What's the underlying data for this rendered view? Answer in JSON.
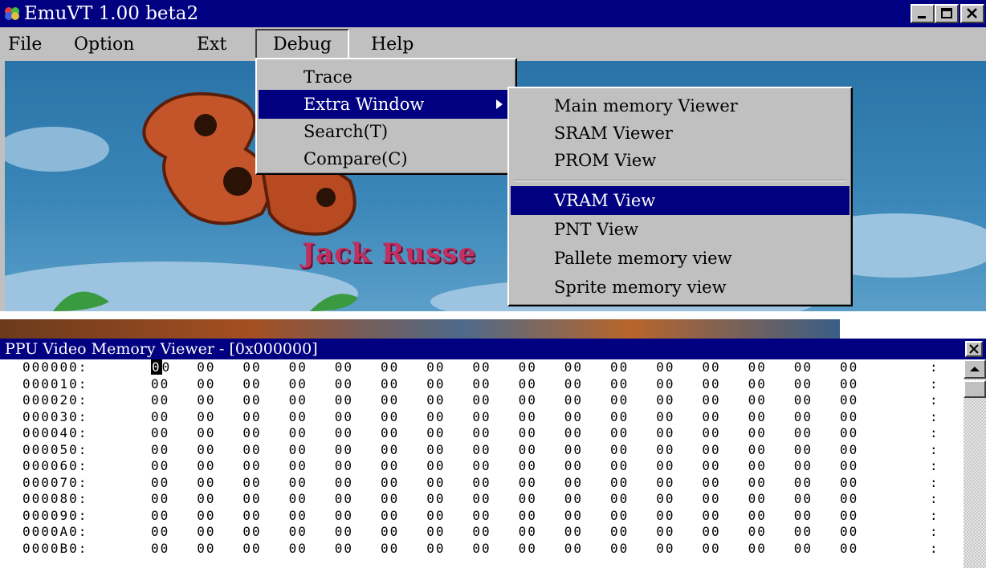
{
  "main_window": {
    "title": "EmuVT 1.00 beta2",
    "controls": [
      "minimize-icon",
      "maximize-icon",
      "close-icon"
    ]
  },
  "menubar": {
    "items": [
      "File",
      "Option",
      "Ext",
      "Debug",
      "Help"
    ],
    "open_item": "Debug"
  },
  "debug_menu": {
    "items": [
      "Trace",
      "Extra Window",
      "Search(T)",
      "Compare(C)"
    ],
    "selected": "Extra Window"
  },
  "extra_window_submenu": {
    "items_top": [
      "Main memory Viewer",
      "SRAM Viewer",
      "PROM View"
    ],
    "items_bottom": [
      "VRAM View",
      "PNT View",
      "Pallete memory view",
      "Sprite memory view"
    ],
    "selected": "VRAM View"
  },
  "game_screen": {
    "caption": "Jack Russe"
  },
  "ppu_viewer": {
    "title": "PPU Video Memory Viewer - [0x000000]",
    "rows": [
      {
        "addr": "000000:",
        "bytes": "00 00 00 00 00 00 00 00 00 00 00 00 00 00 00 00",
        "ascii": ":"
      },
      {
        "addr": "000010:",
        "bytes": "00 00 00 00 00 00 00 00 00 00 00 00 00 00 00 00",
        "ascii": ":"
      },
      {
        "addr": "000020:",
        "bytes": "00 00 00 00 00 00 00 00 00 00 00 00 00 00 00 00",
        "ascii": ":"
      },
      {
        "addr": "000030:",
        "bytes": "00 00 00 00 00 00 00 00 00 00 00 00 00 00 00 00",
        "ascii": ":"
      },
      {
        "addr": "000040:",
        "bytes": "00 00 00 00 00 00 00 00 00 00 00 00 00 00 00 00",
        "ascii": ":"
      },
      {
        "addr": "000050:",
        "bytes": "00 00 00 00 00 00 00 00 00 00 00 00 00 00 00 00",
        "ascii": ":"
      },
      {
        "addr": "000060:",
        "bytes": "00 00 00 00 00 00 00 00 00 00 00 00 00 00 00 00",
        "ascii": ":"
      },
      {
        "addr": "000070:",
        "bytes": "00 00 00 00 00 00 00 00 00 00 00 00 00 00 00 00",
        "ascii": ":"
      },
      {
        "addr": "000080:",
        "bytes": "00 00 00 00 00 00 00 00 00 00 00 00 00 00 00 00",
        "ascii": ":"
      },
      {
        "addr": "000090:",
        "bytes": "00 00 00 00 00 00 00 00 00 00 00 00 00 00 00 00",
        "ascii": ":"
      },
      {
        "addr": "0000A0:",
        "bytes": "00 00 00 00 00 00 00 00 00 00 00 00 00 00 00 00",
        "ascii": ":"
      },
      {
        "addr": "0000B0:",
        "bytes": "00 00 00 00 00 00 00 00 00 00 00 00 00 00 00 00",
        "ascii": ":"
      }
    ]
  },
  "colors": {
    "titlebar": "#000080",
    "menu_highlight": "#000080",
    "window_face": "#c0c0c0"
  }
}
